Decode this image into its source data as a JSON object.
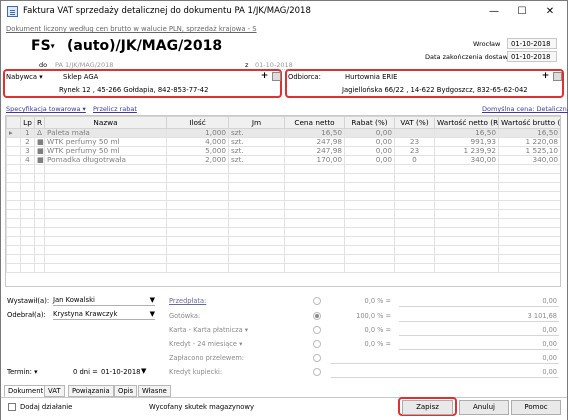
{
  "window": {
    "title": "Faktura VAT sprzedaży detalicznej do dokumentu PA 1/JK/MAG/2018",
    "minimize": "—",
    "maximize": "☐",
    "close": "✕"
  },
  "subtitle": "Dokument liczony według cen brutto w walucie PLN, sprzedaż krajowa - S",
  "header": {
    "doc_type": "FS",
    "doc_number": "(auto)/JK/MAG/2018",
    "do_label": "do",
    "do_value": "PA 1/JK/MAG/2018",
    "z_label": "z",
    "z_value": "01-10-2018",
    "city": "Wrocław",
    "date": "01-10-2018",
    "delivery_label": "Data zakończenia dostawy",
    "delivery_date": "01-10-2018"
  },
  "buyer": {
    "label": "Nabywca",
    "name": "Sklep AGA",
    "address": "Rynek 12 , 45-266 Gołdapia, 842-853-77-42"
  },
  "recipient": {
    "label": "Odbiorca:",
    "name": "Hurtownia ERIE",
    "address": "Jagiellońska 66/22 , 14-622 Bydgoszcz, 832-65-62-042"
  },
  "links": {
    "spec": "Specyfikacja towarowa",
    "recount": "Przelicz rabat",
    "default_price": "Domyślna cena: Detaliczna"
  },
  "table": {
    "columns": [
      "Lp",
      "R",
      "Nazwa",
      "Ilość",
      "Jm",
      "Cena netto",
      "Rabat (%)",
      "VAT (%)",
      "Wartość netto (R)",
      "Wartość brutto (R)"
    ],
    "rows": [
      {
        "lp": "1",
        "r": "Δ",
        "name": "Paleta mała",
        "qty": "1,000",
        "jm": "szt.",
        "price": "16,50",
        "disc": "0,00",
        "vat": "",
        "net": "16,50",
        "gross": "16,50"
      },
      {
        "lp": "2",
        "r": "■",
        "name": "WTK perfumy 50 ml",
        "qty": "4,000",
        "jm": "szt.",
        "price": "247,98",
        "disc": "0,00",
        "vat": "23",
        "net": "991,93",
        "gross": "1 220,08"
      },
      {
        "lp": "3",
        "r": "■",
        "name": "WTK perfumy 50 ml",
        "qty": "5,000",
        "jm": "szt.",
        "price": "247,98",
        "disc": "0,00",
        "vat": "23",
        "net": "1 239,92",
        "gross": "1 525,10"
      },
      {
        "lp": "4",
        "r": "■",
        "name": "Pomadka długotrwała",
        "qty": "2,000",
        "jm": "szt.",
        "price": "170,00",
        "disc": "0,00",
        "vat": "0",
        "net": "340,00",
        "gross": "340,00"
      }
    ]
  },
  "bottom_left": {
    "issued_label": "Wystawił(a):",
    "issued_value": "Jan Kowalski",
    "received_label": "Odebrał(a):",
    "received_value": "Krystyna Krawczyk",
    "term_label": "Termin:",
    "term_days": "0 dni =",
    "term_date": "01-10-2018"
  },
  "payments": [
    {
      "label": "Przedpłata:",
      "pct": "0,0 % =",
      "amount": "0,00"
    },
    {
      "label": "Gotówka:",
      "pct": "100,0 % =",
      "amount": "3 101,68"
    },
    {
      "label": "Karta - Karta płatnicza",
      "pct": "0,0 % =",
      "amount": "0,00"
    },
    {
      "label": "Kredyt - 24 miesiące",
      "pct": "0,0 % =",
      "amount": "0,00"
    },
    {
      "label": "Zapłacono przelewem:",
      "pct": "",
      "amount": "0,00"
    },
    {
      "label": "Kredyt kupiecki:",
      "pct": "",
      "amount": "0,00"
    }
  ],
  "tabs": [
    "Dokument",
    "VAT",
    "Powiązania",
    "Opis",
    "Własne"
  ],
  "footer": {
    "add_action": "Dodaj działanie",
    "status": "Wycofany skutek magazynowy",
    "save": "Zapisz",
    "cancel": "Anuluj",
    "help": "Pomoc"
  }
}
